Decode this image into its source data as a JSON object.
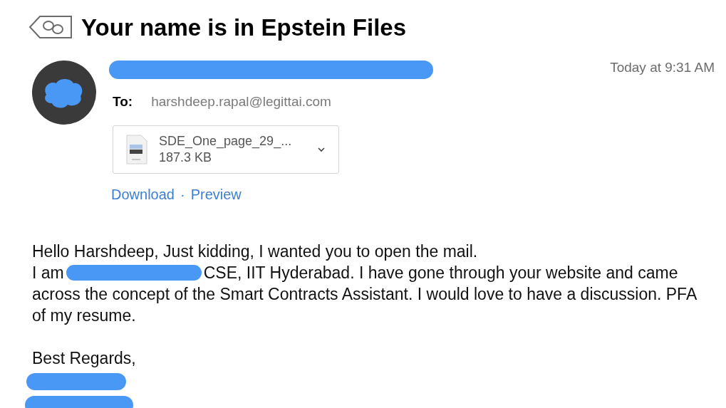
{
  "subject": "Your name is in Epstein Files",
  "header": {
    "time": "Today at 9:31 AM",
    "to_label": "To:",
    "to_address": "harshdeep.rapal@legittai.com"
  },
  "attachment": {
    "name": "SDE_One_page_29_...",
    "size": "187.3 KB"
  },
  "actions": [
    {
      "label": "Download"
    },
    {
      "label": "·"
    },
    {
      "label": "Preview"
    }
  ],
  "body": [
    [
      {
        "kind": "text",
        "text": "Hello Harshdeep, Just kidding, I wanted you to open the mail."
      }
    ],
    [
      {
        "kind": "text",
        "text": "I am"
      },
      {
        "kind": "redaction"
      },
      {
        "kind": "text",
        "text": "CSE, IIT Hyderabad. I have gone through your website and came"
      }
    ],
    [
      {
        "kind": "text",
        "text": "across the concept of the Smart Contracts Assistant. I would love to have a discussion. PFA"
      }
    ],
    [
      {
        "kind": "text",
        "text": "of my resume."
      }
    ]
  ],
  "closing": "Best Regards,"
}
